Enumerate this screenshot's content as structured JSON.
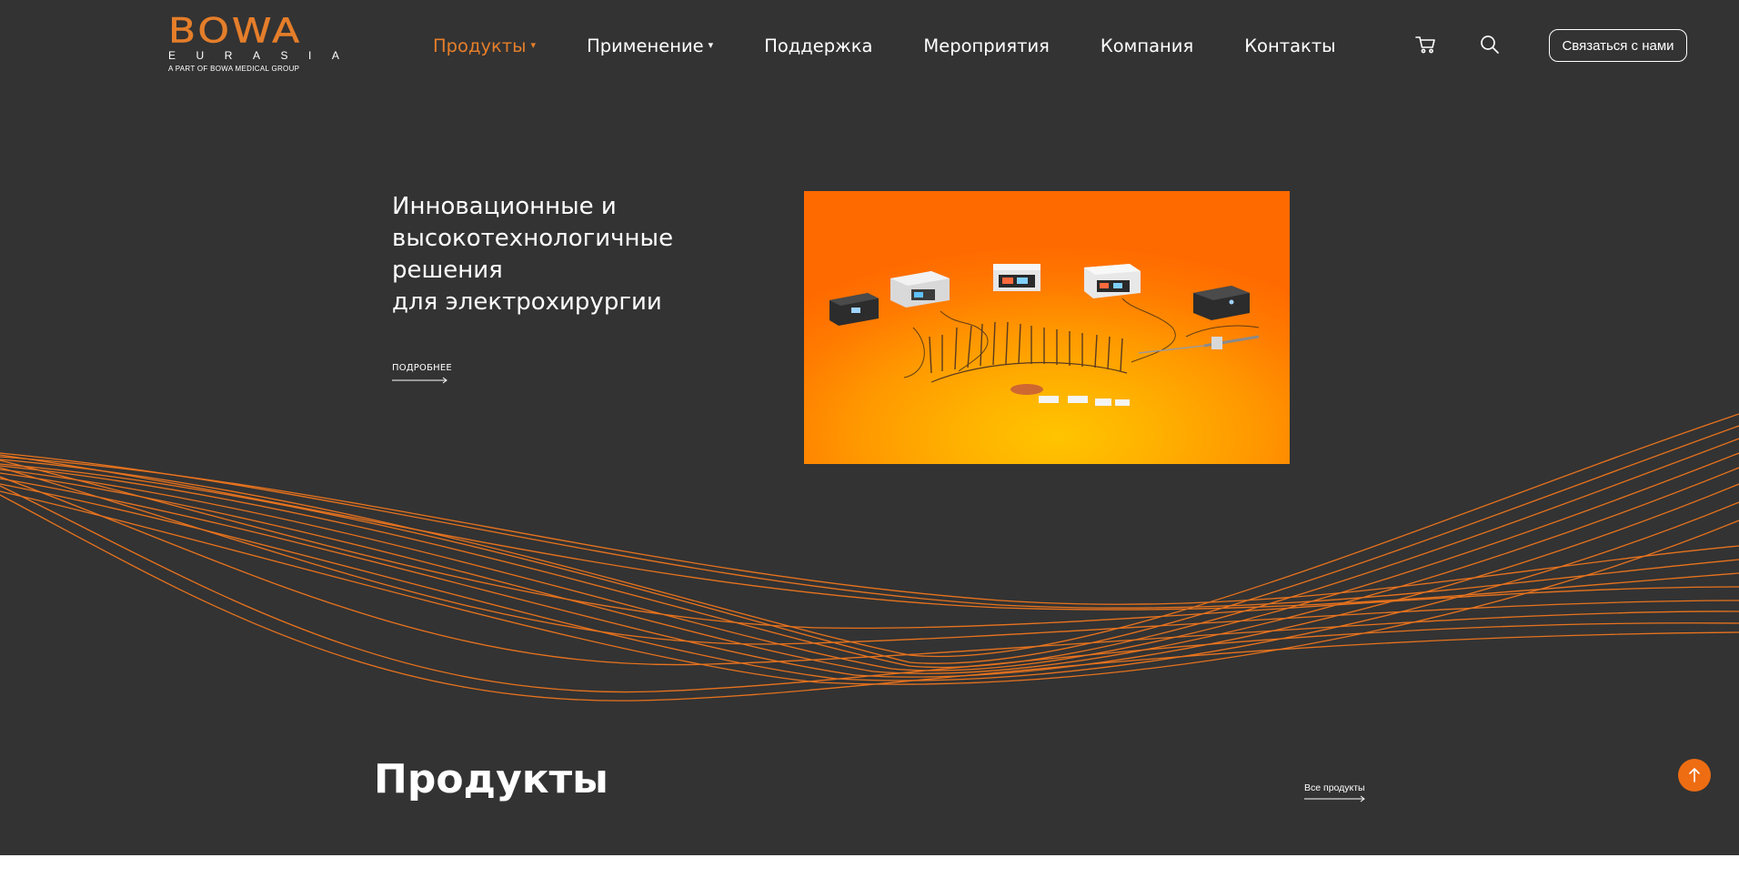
{
  "brand": {
    "logo_main": "BOWA",
    "logo_sub_letters": [
      "E",
      "U",
      "R",
      "A",
      "S",
      "I",
      "A"
    ],
    "logo_tagline": "A PART OF BOWA MEDICAL GROUP",
    "accent_color": "#e57e2a"
  },
  "nav": {
    "items": [
      {
        "label": "Продукты",
        "active": true,
        "has_dropdown": true
      },
      {
        "label": "Применение",
        "active": false,
        "has_dropdown": true
      },
      {
        "label": "Поддержка",
        "active": false,
        "has_dropdown": false
      },
      {
        "label": "Мероприятия",
        "active": false,
        "has_dropdown": false
      },
      {
        "label": "Компания",
        "active": false,
        "has_dropdown": false
      },
      {
        "label": "Контакты",
        "active": false,
        "has_dropdown": false
      }
    ],
    "dropdown_caret": "▾",
    "cart_icon": "cart-icon",
    "search_icon": "search-icon",
    "contact_button": "Связаться с нами"
  },
  "hero": {
    "title_lines": [
      "Инновационные и",
      "высокотехнологичные",
      "решения",
      "для электрохирургии"
    ],
    "more_link": "ПОДРОБНЕЕ",
    "image_alt_icon": "product-lineup-image"
  },
  "products": {
    "title": "Продукты",
    "all_link": "Все продукты"
  },
  "scroll_top": {
    "icon": "arrow-up-icon",
    "glyph": "↑",
    "color": "#ee6d13"
  }
}
